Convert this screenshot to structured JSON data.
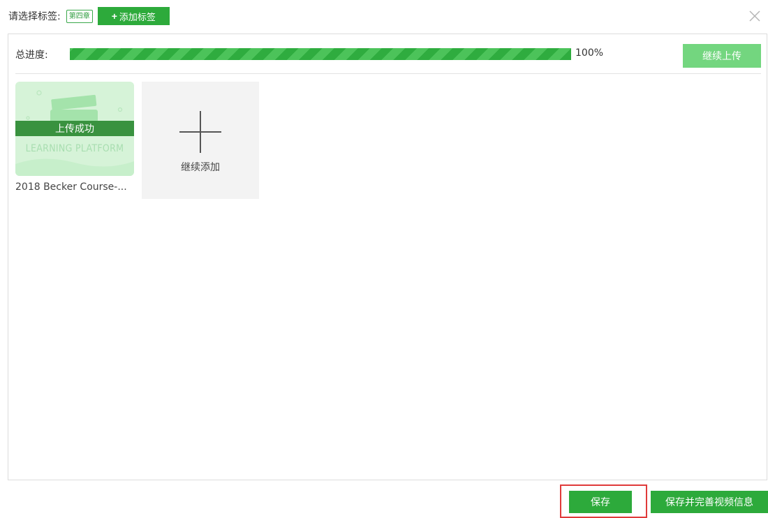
{
  "tags": {
    "label": "请选择标签:",
    "selected_tag": "第四章",
    "add_tag_button": "添加标签",
    "add_icon": "plus-icon"
  },
  "close_icon": "close-icon",
  "progress": {
    "label": "总进度:",
    "percent_text": "100%",
    "fraction": 1.0,
    "continue_upload_button": "继续上传"
  },
  "files": [
    {
      "status": "上传成功",
      "thumbnail_watermark": "LEARNING PLATFORM",
      "name": "2018 Becker Course-..."
    }
  ],
  "add_more": {
    "label": "继续添加",
    "icon": "plus-icon"
  },
  "footer": {
    "save_button": "保存",
    "save_complete_button": "保存并完善视频信息"
  },
  "colors": {
    "accent": "#2daa3b",
    "accent_light": "#73d67f",
    "highlight": "#e03a3a"
  }
}
